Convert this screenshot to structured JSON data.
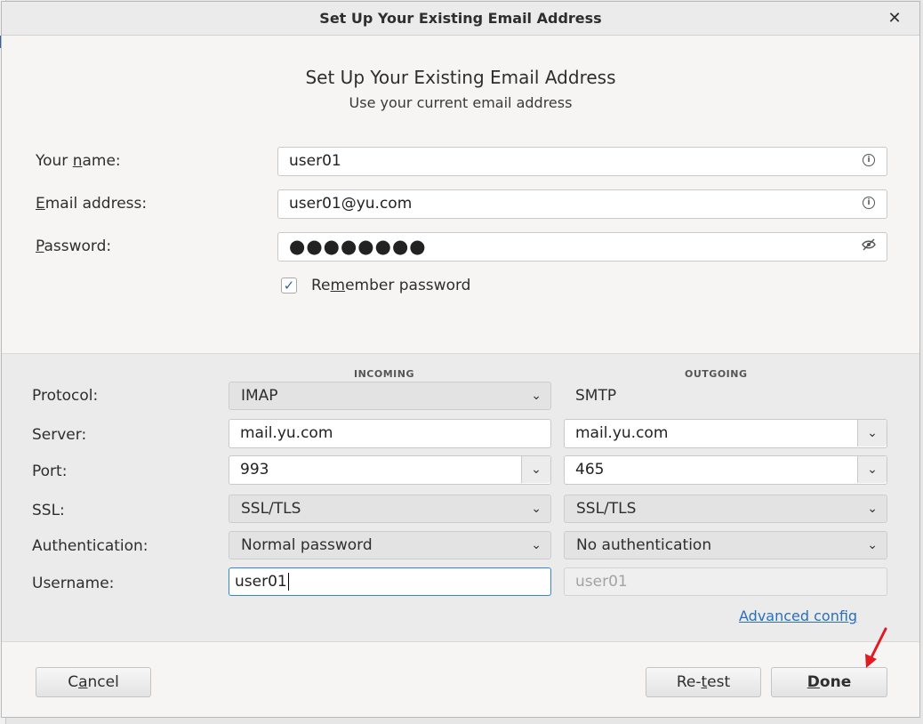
{
  "dialog": {
    "title": "Set Up Your Existing Email Address",
    "heading": "Set Up Your Existing Email Address",
    "subheading": "Use your current email address"
  },
  "account": {
    "name_label_pre": "Your ",
    "name_label_key": "n",
    "name_label_post": "ame:",
    "name_value": "user01",
    "email_label_key": "E",
    "email_label_post": "mail address:",
    "email_value": "user01@yu.com",
    "password_label_key": "P",
    "password_label_post": "assword:",
    "password_mask": "●●●●●●●●",
    "remember_pre": "Re",
    "remember_key": "m",
    "remember_post": "ember password",
    "remember_checked": true
  },
  "config": {
    "incoming_header": "INCOMING",
    "outgoing_header": "OUTGOING",
    "labels": {
      "protocol": "Protocol:",
      "server": "Server:",
      "port": "Port:",
      "ssl": "SSL:",
      "authentication": "Authentication:",
      "username": "Username:"
    },
    "incoming": {
      "protocol": "IMAP",
      "server": "mail.yu.com",
      "port": "993",
      "ssl": "SSL/TLS",
      "authentication": "Normal password",
      "username": "user01"
    },
    "outgoing": {
      "protocol": "SMTP",
      "server": "mail.yu.com",
      "port": "465",
      "ssl": "SSL/TLS",
      "authentication": "No authentication",
      "username": "user01"
    },
    "advanced_link": "Advanced config"
  },
  "buttons": {
    "cancel_pre": "C",
    "cancel_key": "a",
    "cancel_post": "ncel",
    "retest_pre": "Re-",
    "retest_key": "t",
    "retest_post": "est",
    "done_key": "D",
    "done_post": "one"
  },
  "colors": {
    "accent": "#3584e4",
    "link": "#2a6fbd",
    "annotation_arrow": "#e01b24"
  },
  "icons": {
    "close": "close-icon",
    "info": "info-icon",
    "password_hidden": "eye-slash-icon",
    "dropdown": "chevron-down-icon",
    "check": "checkmark-icon"
  }
}
